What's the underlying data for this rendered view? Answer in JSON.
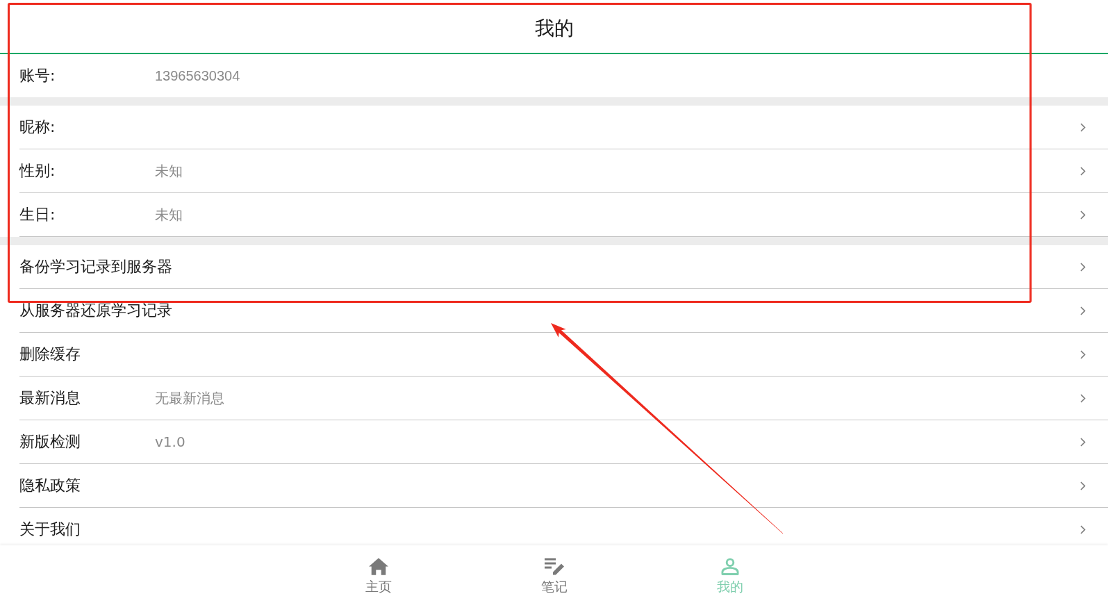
{
  "header": {
    "title": "我的"
  },
  "account": {
    "label": "账号:",
    "value": "13965630304"
  },
  "groups": [
    {
      "items": [
        {
          "label": "昵称:"
        },
        {
          "label": "性别:",
          "value": "未知"
        },
        {
          "label": "生日:",
          "value": "未知"
        }
      ]
    },
    {
      "items": [
        {
          "label": "备份学习记录到服务器"
        },
        {
          "label": "从服务器还原学习记录"
        },
        {
          "label": "删除缓存"
        },
        {
          "label": "最新消息",
          "value": "无最新消息"
        },
        {
          "label": "新版检测",
          "value": "v1.0"
        },
        {
          "label": "隐私政策"
        },
        {
          "label": "关于我们"
        }
      ]
    }
  ],
  "tab_bar": {
    "tabs": [
      {
        "label": "主页",
        "selected": false
      },
      {
        "label": "笔记",
        "selected": false
      },
      {
        "label": "我的",
        "selected": true
      }
    ]
  }
}
